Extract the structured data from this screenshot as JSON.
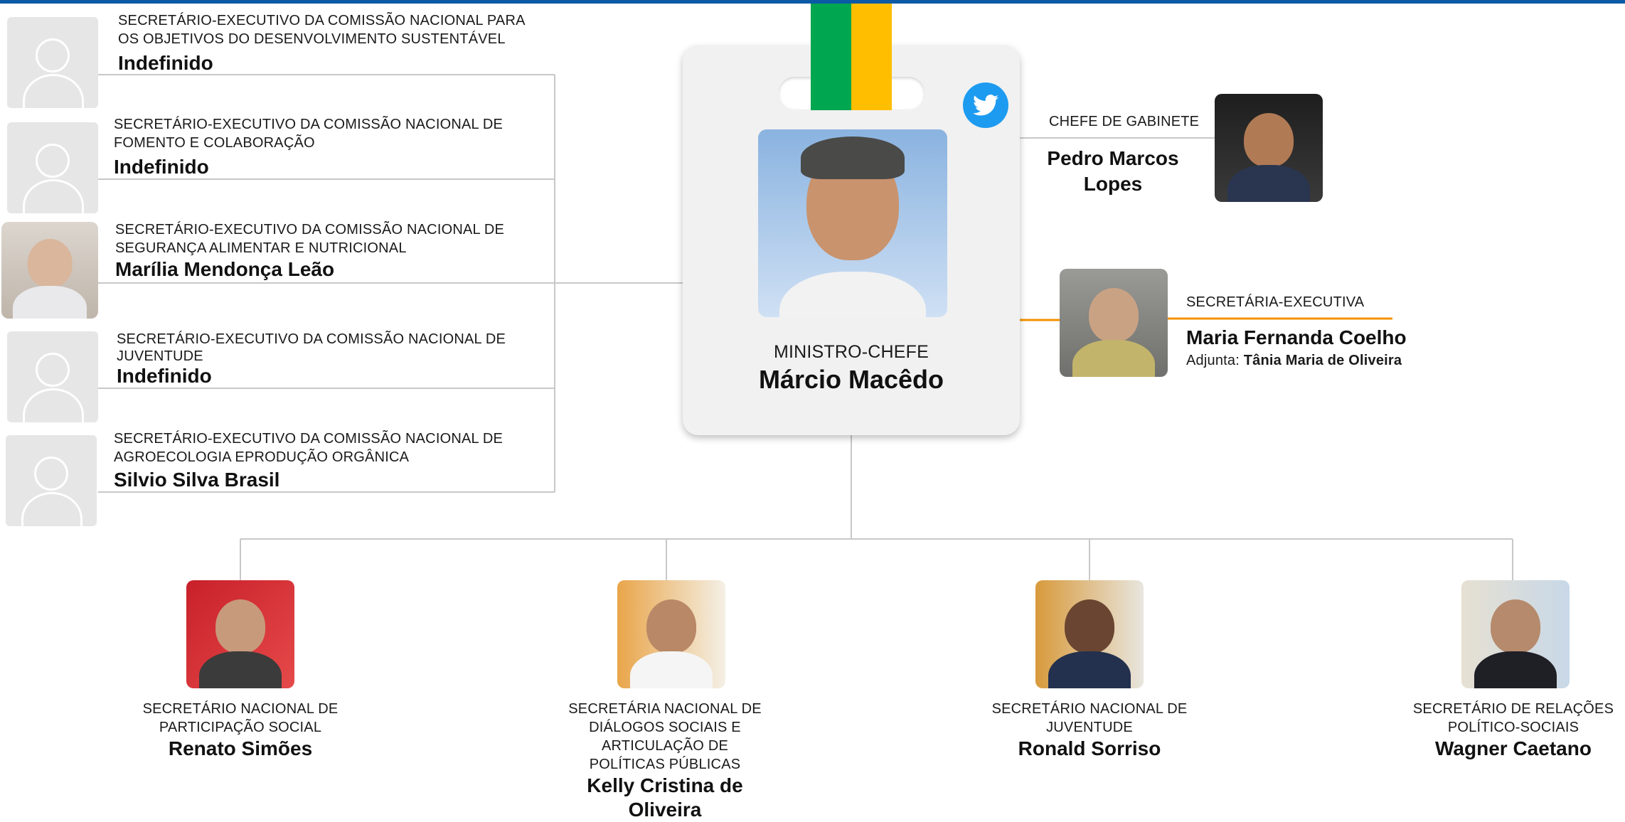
{
  "colors": {
    "top_bar": "#0b5aa6",
    "ribbon_green": "#00a650",
    "ribbon_yellow": "#ffbe00",
    "accent_line": "#f39200",
    "connector": "#c8c8c8",
    "twitter": "#1d9bf0"
  },
  "minister": {
    "role": "MINISTRO-CHEFE",
    "name": "Márcio Macêdo",
    "social_icon": "twitter-icon"
  },
  "chief_of_staff": {
    "role": "CHEFE DE GABINETE",
    "name_line1": "Pedro Marcos",
    "name_line2": "Lopes"
  },
  "executive": {
    "role": "SECRETÁRIA-EXECUTIVA",
    "name": "Maria Fernanda Coelho",
    "deputy_label": "Adjunta:",
    "deputy_name": "Tânia Maria de Oliveira"
  },
  "commissions": [
    {
      "role_line1": "SECRETÁRIO-EXECUTIVO DA COMISSÃO NACIONAL PARA",
      "role_line2": "OS OBJETIVOS DO DESENVOLVIMENTO SUSTENTÁVEL",
      "name": "Indefinido"
    },
    {
      "role_line1": "SECRETÁRIO-EXECUTIVO DA COMISSÃO NACIONAL DE",
      "role_line2": "FOMENTO E COLABORAÇÃO",
      "name": "Indefinido"
    },
    {
      "role_line1": "SECRETÁRIO-EXECUTIVO DA COMISSÃO NACIONAL DE",
      "role_line2": "SEGURANÇA ALIMENTAR E NUTRICIONAL",
      "name": "Marília Mendonça Leão"
    },
    {
      "role_line1": "SECRETÁRIO-EXECUTIVO DA COMISSÃO NACIONAL DE",
      "role_line2": "JUVENTUDE",
      "name": "Indefinido"
    },
    {
      "role_line1": "SECRETÁRIO-EXECUTIVO DA COMISSÃO NACIONAL DE",
      "role_line2": "AGROECOLOGIA EPRODUÇÃO ORGÂNICA",
      "name": "Silvio Silva Brasil"
    }
  ],
  "secretaries": [
    {
      "role_lines": [
        "SECRETÁRIO NACIONAL DE",
        "PARTICIPAÇÃO SOCIAL"
      ],
      "name_lines": [
        "Renato Simões"
      ]
    },
    {
      "role_lines": [
        "SECRETÁRIA NACIONAL DE",
        "DIÁLOGOS SOCIAIS E",
        "ARTICULAÇÃO DE",
        "POLÍTICAS PÚBLICAS"
      ],
      "name_lines": [
        "Kelly Cristina de",
        "Oliveira"
      ]
    },
    {
      "role_lines": [
        "SECRETÁRIO NACIONAL DE",
        "JUVENTUDE"
      ],
      "name_lines": [
        "Ronald Sorriso"
      ]
    },
    {
      "role_lines": [
        "SECRETÁRIO DE RELAÇÕES",
        "POLÍTICO-SOCIAIS"
      ],
      "name_lines": [
        "Wagner Caetano"
      ]
    }
  ]
}
